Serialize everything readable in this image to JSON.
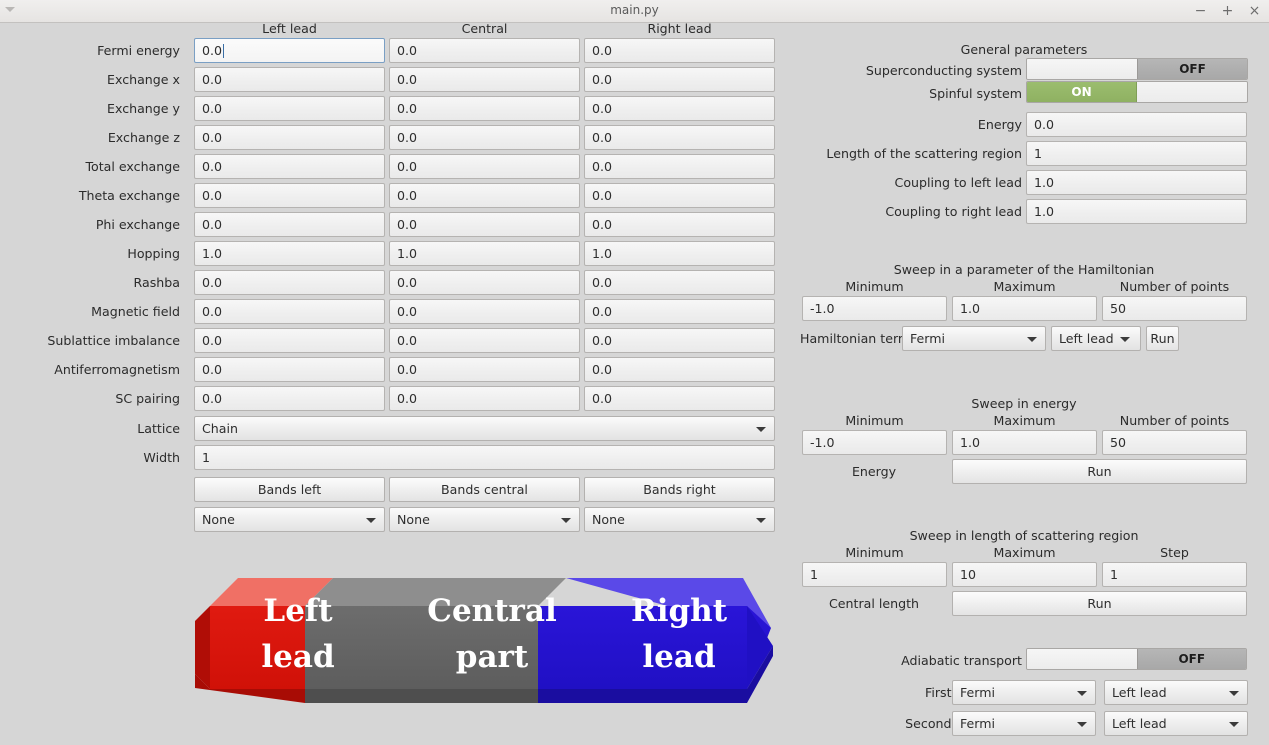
{
  "window": {
    "title": "main.py",
    "menu_icon": "triangle-down-icon",
    "minimize_label": "−",
    "maximize_label": "+",
    "close_label": "×"
  },
  "left_panel": {
    "column_headers": [
      "Left lead",
      "Central",
      "Right lead"
    ],
    "rows": [
      {
        "label": "Fermi energy",
        "values": [
          "0.0",
          "0.0",
          "0.0"
        ],
        "focused": true
      },
      {
        "label": "Exchange x",
        "values": [
          "0.0",
          "0.0",
          "0.0"
        ],
        "focused": false
      },
      {
        "label": "Exchange y",
        "values": [
          "0.0",
          "0.0",
          "0.0"
        ],
        "focused": false
      },
      {
        "label": "Exchange z",
        "values": [
          "0.0",
          "0.0",
          "0.0"
        ],
        "focused": false
      },
      {
        "label": "Total exchange",
        "values": [
          "0.0",
          "0.0",
          "0.0"
        ],
        "focused": false
      },
      {
        "label": "Theta exchange",
        "values": [
          "0.0",
          "0.0",
          "0.0"
        ],
        "focused": false
      },
      {
        "label": "Phi exchange",
        "values": [
          "0.0",
          "0.0",
          "0.0"
        ],
        "focused": false
      },
      {
        "label": "Hopping",
        "values": [
          "1.0",
          "1.0",
          "1.0"
        ],
        "focused": false
      },
      {
        "label": "Rashba",
        "values": [
          "0.0",
          "0.0",
          "0.0"
        ],
        "focused": false
      },
      {
        "label": "Magnetic field",
        "values": [
          "0.0",
          "0.0",
          "0.0"
        ],
        "focused": false
      },
      {
        "label": "Sublattice imbalance",
        "values": [
          "0.0",
          "0.0",
          "0.0"
        ],
        "focused": false
      },
      {
        "label": "Antiferromagnetism",
        "values": [
          "0.0",
          "0.0",
          "0.0"
        ],
        "focused": false
      },
      {
        "label": "SC pairing",
        "values": [
          "0.0",
          "0.0",
          "0.0"
        ],
        "focused": false
      }
    ],
    "lattice": {
      "label": "Lattice",
      "value": "Chain"
    },
    "width": {
      "label": "Width",
      "value": "1"
    },
    "bands_buttons": [
      "Bands left",
      "Bands central",
      "Bands right"
    ],
    "bands_selects": [
      "None",
      "None",
      "None"
    ]
  },
  "device_diagram": {
    "left_text": "Left\nlead",
    "central_text": "Central\npart",
    "right_text": "Right\nlead",
    "left_color": "#d61414",
    "central_color": "#666666",
    "right_color": "#2211cc"
  },
  "general_parameters": {
    "title": "General parameters",
    "superconducting": {
      "label": "Superconducting system",
      "state": "OFF"
    },
    "spinful": {
      "label": "Spinful system",
      "state": "ON"
    },
    "energy": {
      "label": "Energy",
      "value": "0.0"
    },
    "length": {
      "label": "Length of the scattering region",
      "value": "1"
    },
    "coupling_left": {
      "label": "Coupling to left lead",
      "value": "1.0"
    },
    "coupling_right": {
      "label": "Coupling to right lead",
      "value": "1.0"
    }
  },
  "sweep_hamiltonian": {
    "title": "Sweep in a parameter of the Hamiltonian",
    "headers": [
      "Minimum",
      "Maximum",
      "Number of points"
    ],
    "values": [
      "-1.0",
      "1.0",
      "50"
    ],
    "term_label": "Hamiltonian term",
    "term_value": "Fermi",
    "region_value": "Left lead",
    "run_label": "Run"
  },
  "sweep_energy": {
    "title": "Sweep in energy",
    "headers": [
      "Minimum",
      "Maximum",
      "Number of points"
    ],
    "values": [
      "-1.0",
      "1.0",
      "50"
    ],
    "row_label": "Energy",
    "run_label": "Run"
  },
  "sweep_length": {
    "title": "Sweep in length of scattering region",
    "headers": [
      "Minimum",
      "Maximum",
      "Step"
    ],
    "values": [
      "1",
      "10",
      "1"
    ],
    "row_label": "Central length",
    "run_label": "Run"
  },
  "adiabatic": {
    "label": "Adiabatic transport",
    "state": "OFF",
    "first_label": "First parameter",
    "first_term": "Fermi",
    "first_region": "Left lead",
    "second_label": "Second parameter",
    "second_term": "Fermi",
    "second_region": "Left lead"
  },
  "colors": {
    "background": "#d6d6d6",
    "toggle_on": "#9bbd6e",
    "toggle_off": "#b6b6b6",
    "focus_border": "#7a9fc4"
  }
}
